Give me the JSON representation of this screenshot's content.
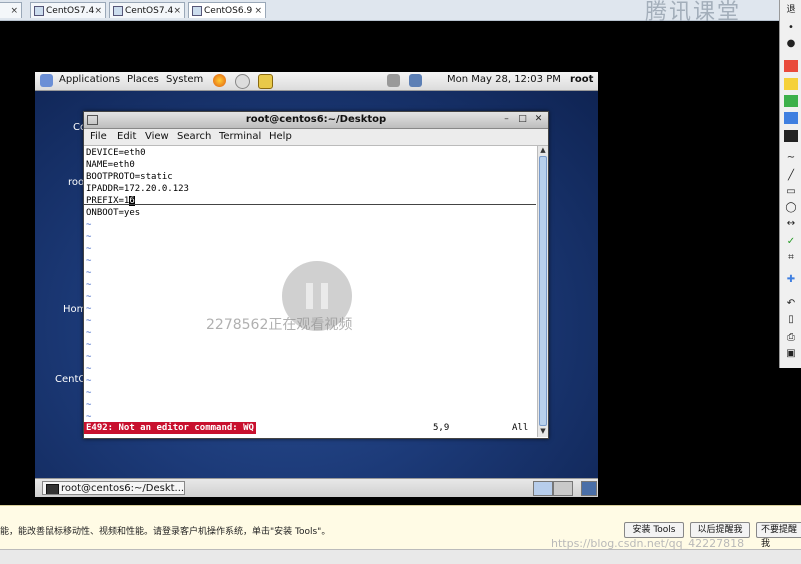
{
  "host_tabs": [
    {
      "label": "CentOS7.4"
    },
    {
      "label": "CentOS7.4"
    },
    {
      "label": "CentOS6.9"
    }
  ],
  "top_watermark": "腾讯课堂",
  "gnome_panel": {
    "menus": [
      "Applications",
      "Places",
      "System"
    ],
    "clock": "Mon May 28, 12:03 PM",
    "user": "root"
  },
  "desktop_labels": [
    "Co",
    "roo",
    "Hom",
    "CentO"
  ],
  "terminal": {
    "title": "root@centos6:~/Desktop",
    "menus": [
      "File",
      "Edit",
      "View",
      "Search",
      "Terminal",
      "Help"
    ],
    "lines": [
      "DEVICE=eth0",
      "NAME=eth0",
      "BOOTPROTO=static",
      "IPADDR=172.20.0.123"
    ],
    "prefix_before": "PREFIX=1",
    "prefix_cursor": "6",
    "last_line": "ONBOOT=yes",
    "tilde": "~",
    "error": "E492: Not an editor command: WQ",
    "position": "5,9",
    "scroll_pos": "All"
  },
  "overlay_text": "2278562正在观看视频",
  "taskbar": {
    "task_label": "root@centos6:~/Deskt..."
  },
  "tools_bar": {
    "message": "能，能改善鼠标移动性、视频和性能。请登录客户机操作系统，单击\"安装 Tools\"。",
    "install_button": "安装 Tools",
    "remind_later_button": "以后提醒我",
    "dont_remind_button": "不要提醒我"
  },
  "csdn_watermark": "https://blog.csdn.net/qq_42227818",
  "colors": {
    "error_bg": "#c8102e",
    "tilde": "#3b63c4",
    "desktop": "#1c3a78"
  }
}
